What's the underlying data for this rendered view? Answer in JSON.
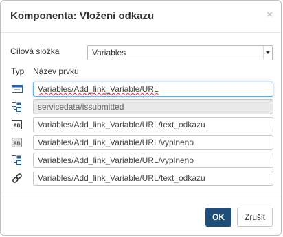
{
  "dialog": {
    "title": "Komponenta: Vložení odkazu",
    "close_symbol": "×"
  },
  "folder": {
    "label": "Cílová složka",
    "selected": "Variables"
  },
  "columns": {
    "type": "Typ",
    "name": "Název prvku"
  },
  "rows": [
    {
      "icon": "textbox-icon",
      "value": "Variables/Add_link_Variable/URL",
      "state": "active"
    },
    {
      "icon": "linked-elements-icon",
      "value": "servicedata/issubmitted",
      "state": "disabled"
    },
    {
      "icon": "label-ab-icon",
      "value": "Variables/Add_link_Variable/URL/text_odkazu",
      "state": "normal"
    },
    {
      "icon": "label-ab-gray-icon",
      "value": "Variables/Add_link_Variable/URL/vyplneno",
      "state": "normal"
    },
    {
      "icon": "linked-elements-icon",
      "value": "Variables/Add_link_Variable/URL/vyplneno",
      "state": "normal"
    },
    {
      "icon": "link-icon",
      "value": "Variables/Add_link_Variable/URL/text_odkazu",
      "state": "normal"
    }
  ],
  "buttons": {
    "ok": "OK",
    "cancel": "Zrušit"
  },
  "colors": {
    "primary": "#1f4e79",
    "icon_blue": "#2b5f9e",
    "focus": "#66afe9"
  }
}
